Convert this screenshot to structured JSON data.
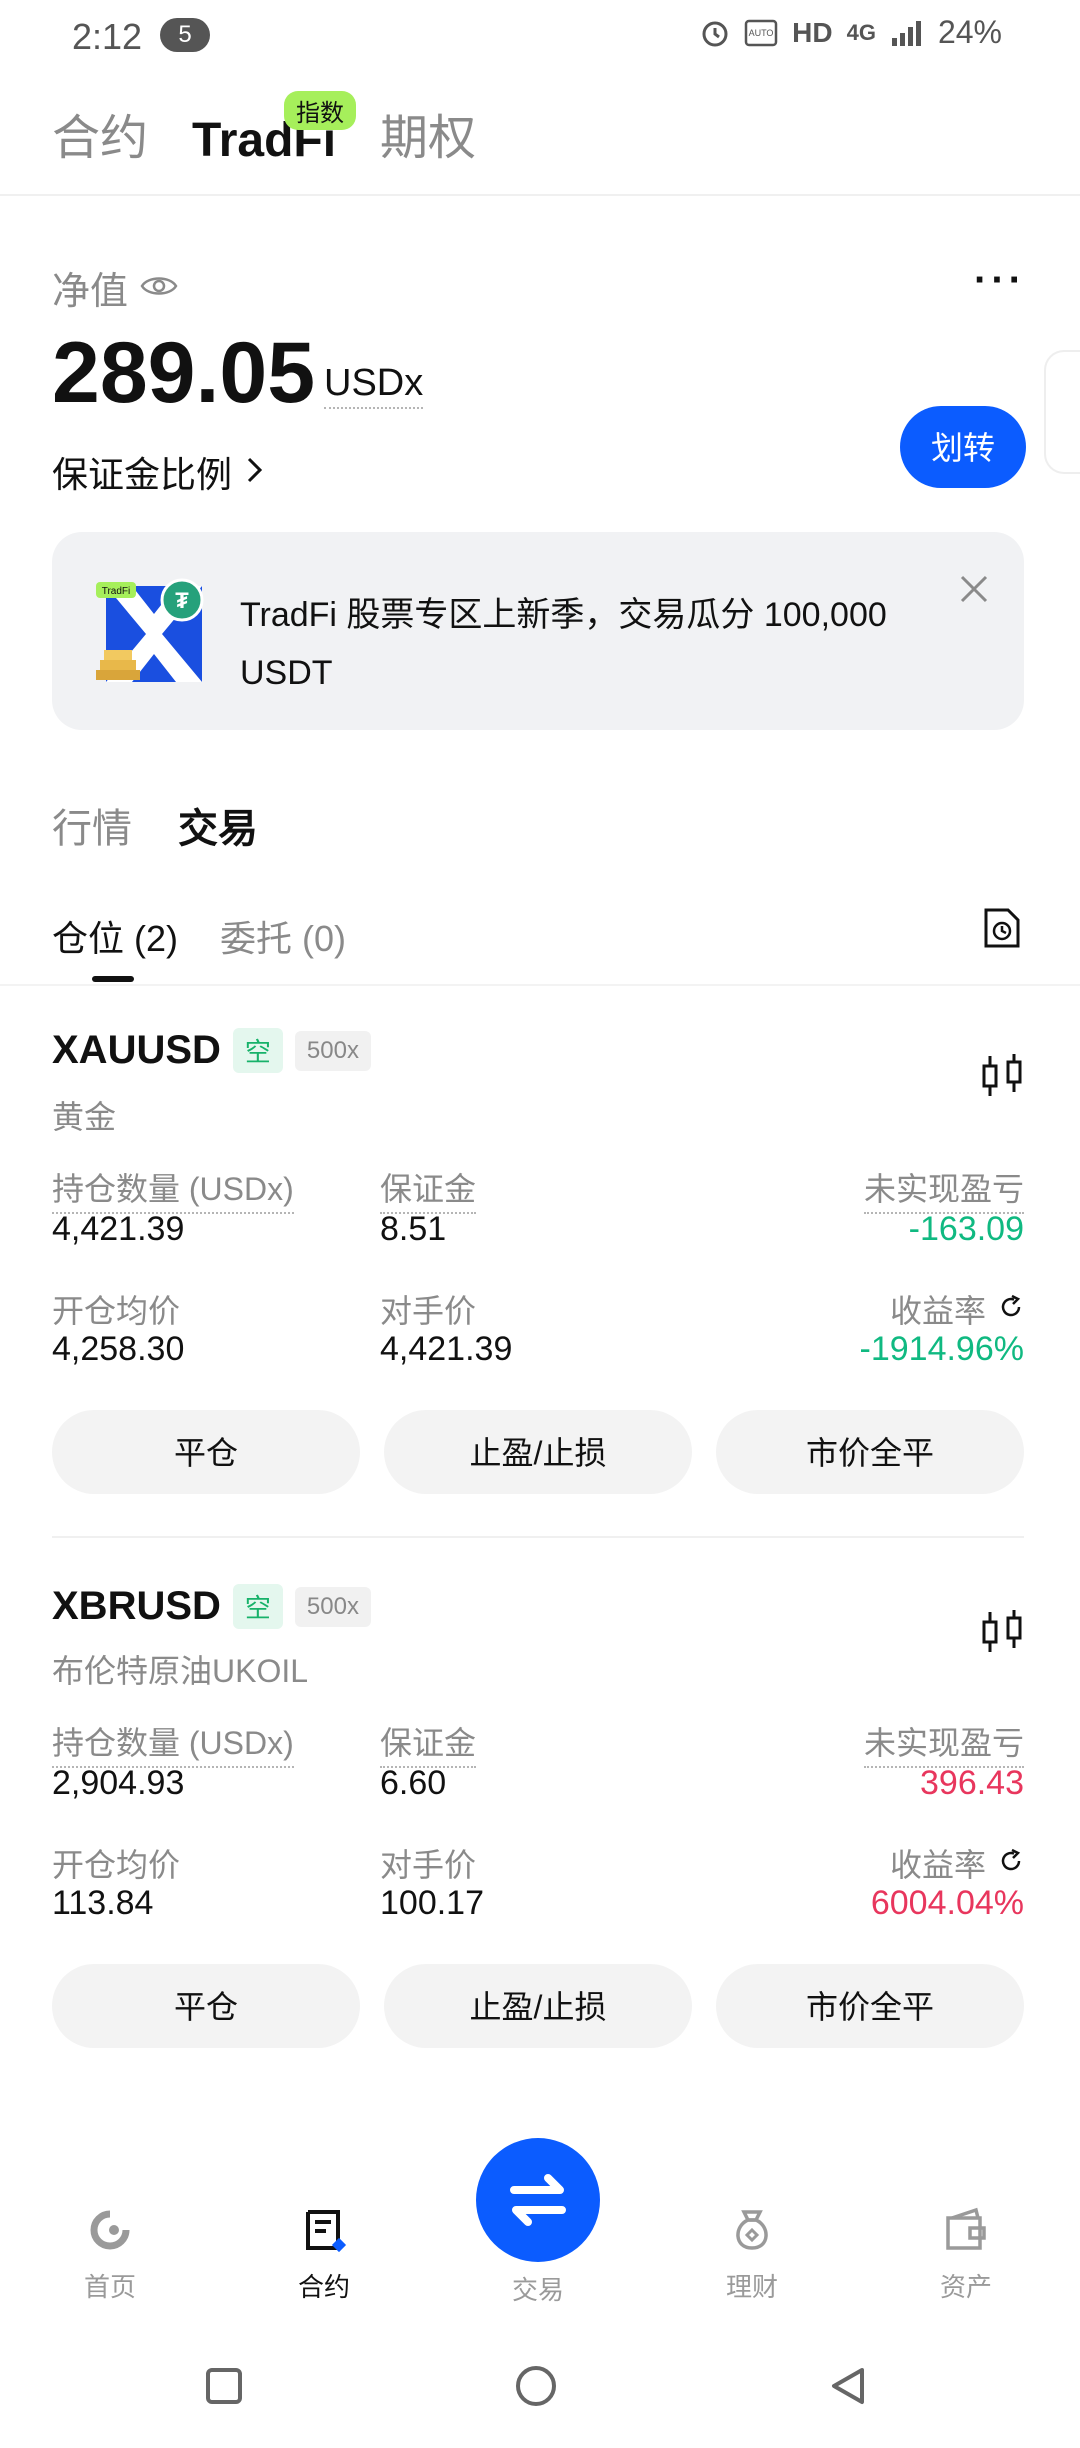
{
  "status_bar": {
    "time": "2:12",
    "notification_count": "5",
    "network": "HD",
    "signal_type": "4G",
    "battery": "24%"
  },
  "top_tabs": [
    {
      "label": "合约",
      "active": false
    },
    {
      "label": "TradFi",
      "active": true,
      "badge": "指数"
    },
    {
      "label": "期权",
      "active": false
    }
  ],
  "account": {
    "equity_label": "净值",
    "equity_value": "289.05",
    "equity_unit": "USDx",
    "margin_ratio_label": "保证金比例",
    "transfer_label": "划转"
  },
  "banner": {
    "text": "TradFi 股票专区上新季，交易瓜分 100,000 USDT",
    "logo_text": "TradFi"
  },
  "section_tabs": [
    {
      "label": "行情",
      "active": false
    },
    {
      "label": "交易",
      "active": true
    }
  ],
  "sub_tabs": [
    {
      "label": "仓位 (2)",
      "active": true
    },
    {
      "label": "委托 (0)",
      "active": false
    }
  ],
  "positions": [
    {
      "symbol": "XAUUSD",
      "side": "空",
      "leverage": "500x",
      "name": "黄金",
      "size_label": "持仓数量 (USDx)",
      "size": "4,421.39",
      "margin_label": "保证金",
      "margin": "8.51",
      "pnl_label": "未实现盈亏",
      "pnl": "-163.09",
      "entry_label": "开仓均价",
      "entry": "4,258.30",
      "mark_label": "对手价",
      "mark": "4,421.39",
      "roe_label": "收益率",
      "roe": "-1914.96%",
      "pnl_color": "#10b981"
    },
    {
      "symbol": "XBRUSD",
      "side": "空",
      "leverage": "500x",
      "name": "布伦特原油UKOIL",
      "size_label": "持仓数量 (USDx)",
      "size": "2,904.93",
      "margin_label": "保证金",
      "margin": "6.60",
      "pnl_label": "未实现盈亏",
      "pnl": "396.43",
      "entry_label": "开仓均价",
      "entry": "113.84",
      "mark_label": "对手价",
      "mark": "100.17",
      "roe_label": "收益率",
      "roe": "6004.04%",
      "pnl_color": "#e8365d"
    }
  ],
  "position_actions": {
    "close": "平仓",
    "tp_sl": "止盈/止损",
    "market_close_all": "市价全平"
  },
  "bottom_nav": [
    {
      "label": "首页",
      "icon": "home-icon",
      "active": false
    },
    {
      "label": "合约",
      "icon": "futures-icon",
      "active": true
    },
    {
      "label": "交易",
      "icon": "swap-icon",
      "active": false
    },
    {
      "label": "理财",
      "icon": "earn-icon",
      "active": false
    },
    {
      "label": "资产",
      "icon": "wallet-icon",
      "active": false
    }
  ],
  "colors": {
    "accent": "#0b5cff",
    "profit": "#e8365d",
    "loss": "#10b981",
    "badge": "#a6ef5b"
  }
}
